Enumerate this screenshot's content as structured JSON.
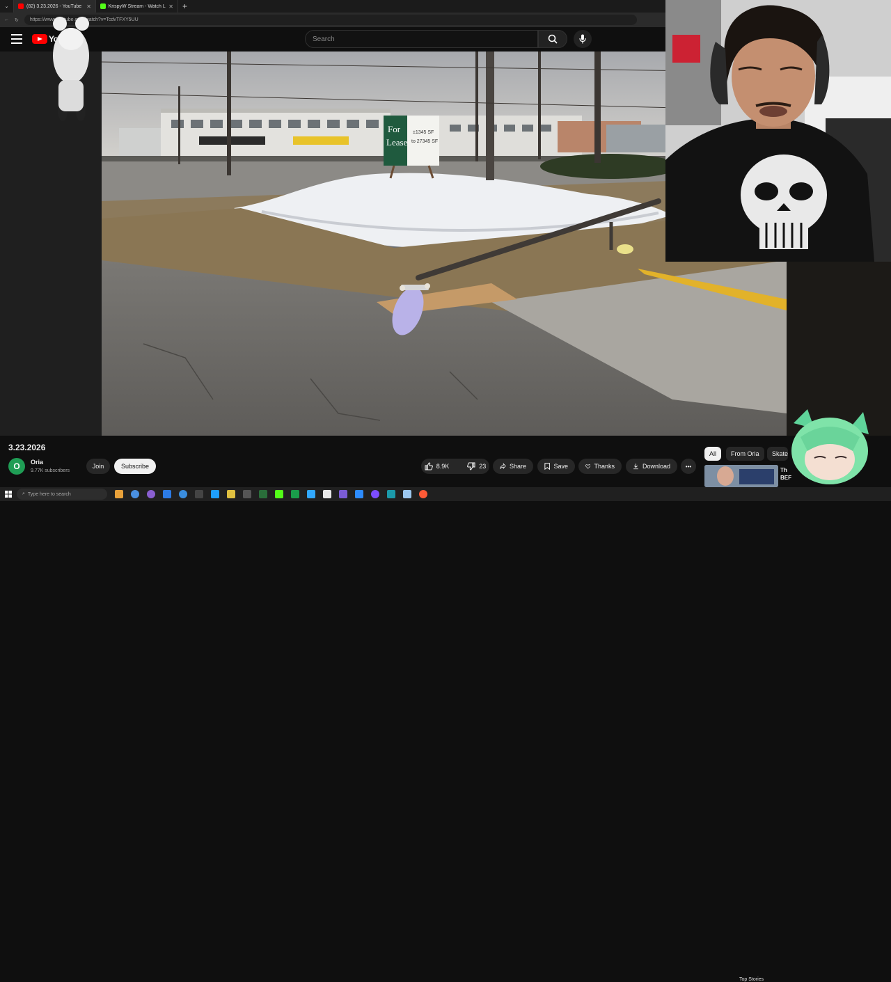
{
  "browser": {
    "tabs": [
      {
        "label": "(82) 3.23.2026 - YouTube",
        "active": true,
        "favicon_color": "#ff0000"
      },
      {
        "label": "KrispyW Stream - Watch Live on K",
        "active": false,
        "favicon_color": "#53fc18"
      }
    ],
    "url": "https://www.youtube.com/watch?v=TcdvTFXY5UU"
  },
  "youtube": {
    "logo_text": "YouTube",
    "search_placeholder": "Search"
  },
  "video": {
    "title": "3.23.2026",
    "sign_text_1": "For",
    "sign_text_2": "Lease",
    "sign_text_3": "±1345 SF",
    "sign_text_4": "to 27345 SF"
  },
  "channel": {
    "avatar_letter": "O",
    "name": "Oria",
    "subscribers": "9.77K subscribers",
    "join_label": "Join",
    "subscribe_label": "Subscribe"
  },
  "actions": {
    "like_count": "8.9K",
    "dislike_count": "23",
    "share_label": "Share",
    "save_label": "Save",
    "thanks_label": "Thanks",
    "download_label": "Download",
    "more_label": "•••"
  },
  "chips": [
    "All",
    "From Oria",
    "Skate"
  ],
  "recommended": {
    "title": "Th BEF"
  },
  "taskbar": {
    "search_placeholder": "Type here to search",
    "top_stories": "Top Stories"
  },
  "colors": {
    "yt_red": "#ff0000",
    "background": "#0f0f0f",
    "avatar": "#1f9d55"
  }
}
